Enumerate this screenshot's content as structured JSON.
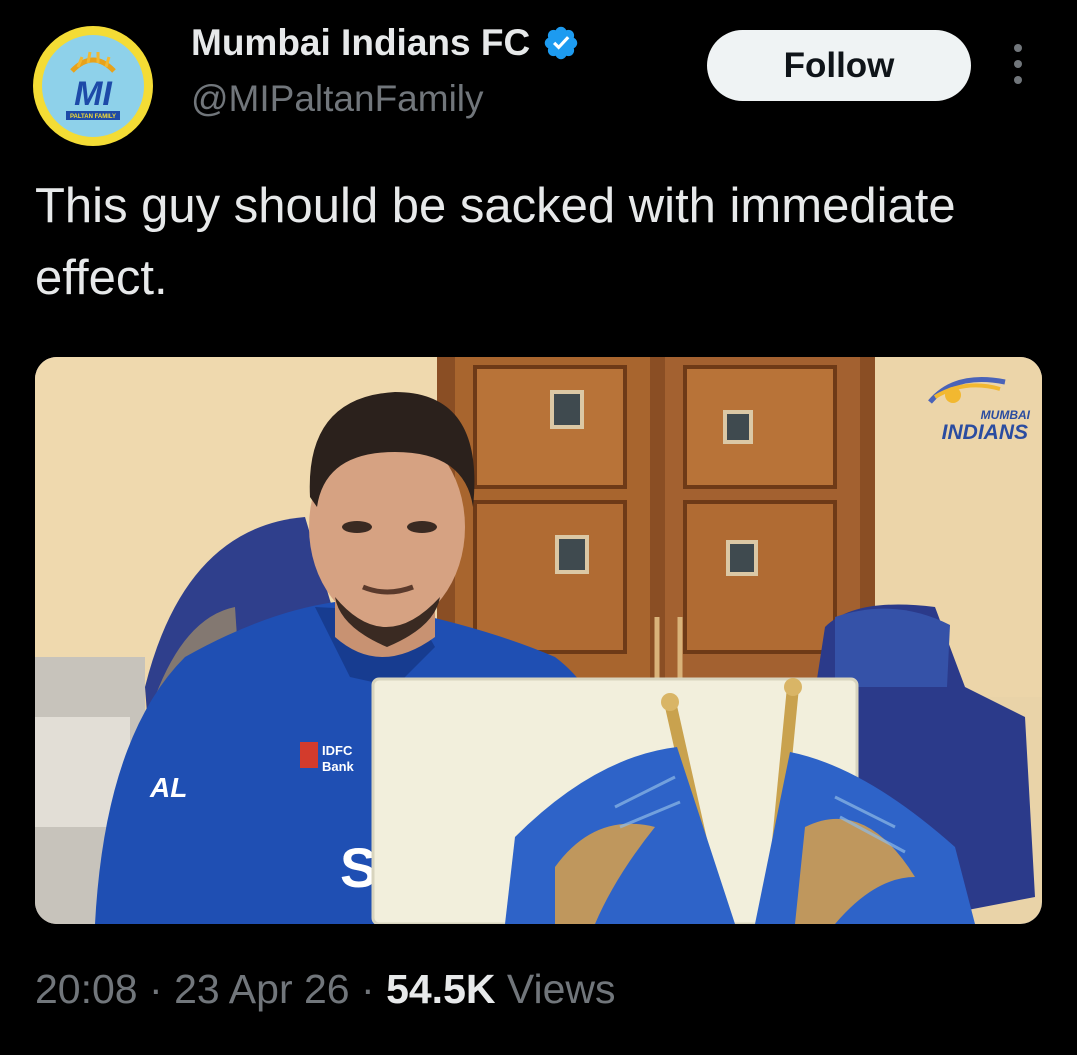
{
  "author": {
    "display_name": "Mumbai Indians FC",
    "handle": "@MIPaltanFamily",
    "verified": true,
    "avatar_text": "MI",
    "avatar_subtext": "PALTAN FAMILY"
  },
  "actions": {
    "follow_label": "Follow",
    "more_icon": "more-vertical-icon"
  },
  "tweet": {
    "text": "This guy should be sacked with immediate effect.",
    "media": {
      "watermark_line1": "MUMBAI",
      "watermark_line2": "INDIANS",
      "jersey_text1": "IDFC",
      "jersey_text2": "Bank",
      "jersey_text3": "AL",
      "jersey_letter": "S"
    }
  },
  "meta": {
    "time": "20:08",
    "separator": "·",
    "date": "23 Apr 26",
    "views_count": "54.5K",
    "views_label": "Views"
  },
  "colors": {
    "background": "#000000",
    "text_primary": "#e7e9ea",
    "text_secondary": "#71767b",
    "verified_blue": "#1d9bf0",
    "follow_bg": "#eff3f4",
    "avatar_ring": "#f4dc35"
  }
}
